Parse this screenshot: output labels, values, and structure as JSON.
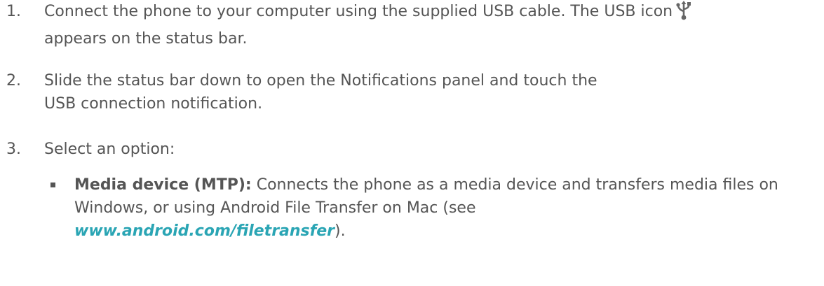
{
  "steps": [
    {
      "number": "1.",
      "text_before_icon": "Connect the phone to your computer using the supplied USB cable. The USB icon",
      "icon": "usb-icon",
      "text_after_icon": "appears on the status bar."
    },
    {
      "number": "2.",
      "text": "Slide the status bar down to open the Notifications panel and touch the USB connection notification."
    },
    {
      "number": "3.",
      "text": "Select an option:"
    }
  ],
  "options": [
    {
      "label": "Media device (MTP):",
      "description": "Connects the phone as a media device and transfers media files on Windows, or using Android File Transfer on Mac (see",
      "link_text": "www.android.com/filetransfer",
      "after_link": ")."
    }
  ],
  "colors": {
    "text": "#555555",
    "link": "#2aa5b4"
  }
}
